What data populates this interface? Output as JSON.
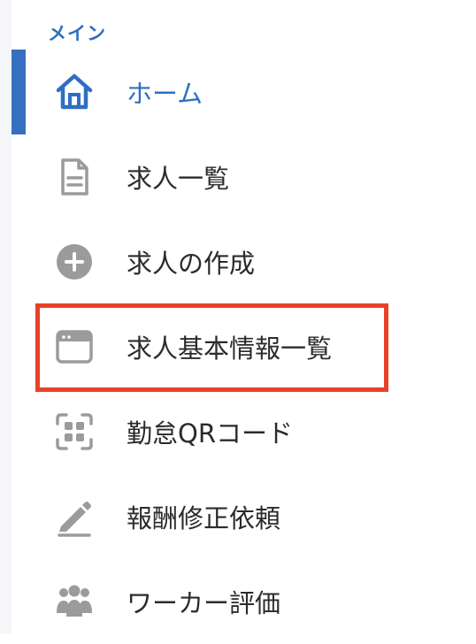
{
  "sidebar": {
    "section_label": "メイン",
    "items": [
      {
        "label": "ホーム",
        "icon": "home-icon",
        "active": true
      },
      {
        "label": "求人一覧",
        "icon": "document-icon"
      },
      {
        "label": "求人の作成",
        "icon": "plus-circle-icon"
      },
      {
        "label": "求人基本情報一覧",
        "icon": "window-icon",
        "highlighted": true
      },
      {
        "label": "勤怠QRコード",
        "icon": "qr-scan-icon"
      },
      {
        "label": "報酬修正依頼",
        "icon": "pencil-icon"
      },
      {
        "label": "ワーカー評価",
        "icon": "users-icon"
      }
    ]
  },
  "colors": {
    "accent": "#2f6fc2",
    "active_bar": "#3570c0",
    "icon_gray": "#9b9b9b",
    "text": "#2b2b2b",
    "highlight": "#e8412a"
  }
}
